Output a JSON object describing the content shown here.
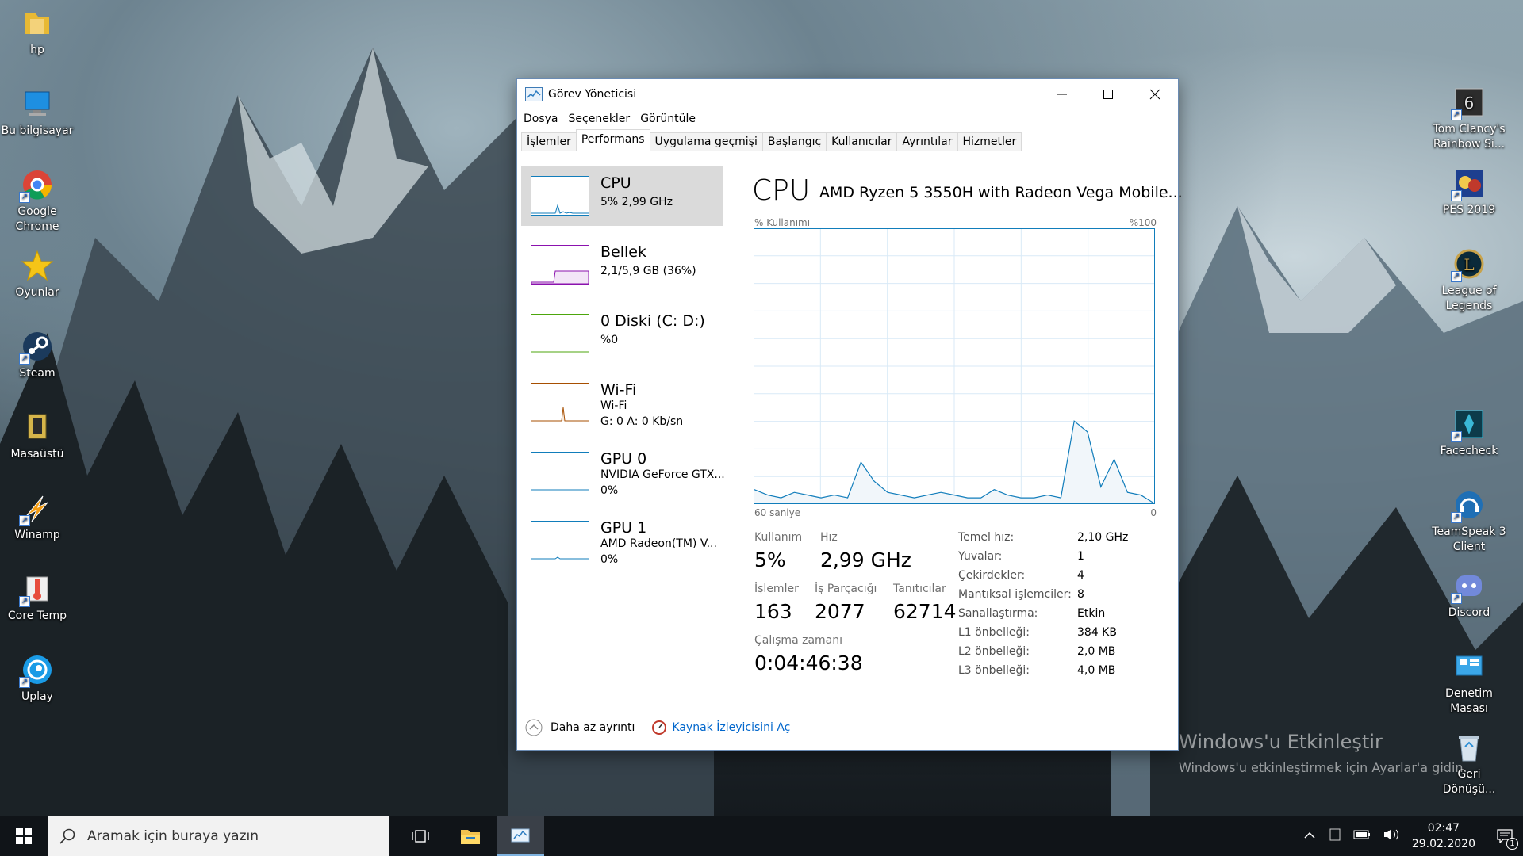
{
  "desktop": {
    "left_icons": [
      {
        "label": "hp",
        "icon": "folder-icon"
      },
      {
        "label": "Bu bilgisayar",
        "icon": "computer-icon"
      },
      {
        "label": "Google Chrome",
        "icon": "chrome-icon"
      },
      {
        "label": "Oyunlar",
        "icon": "star-icon"
      },
      {
        "label": "Steam",
        "icon": "steam-icon"
      },
      {
        "label": "Masaüstü",
        "icon": "folder-icon"
      },
      {
        "label": "Winamp",
        "icon": "winamp-icon"
      },
      {
        "label": "Core Temp",
        "icon": "thermometer-icon"
      },
      {
        "label": "Uplay",
        "icon": "uplay-icon"
      }
    ],
    "right_icons": [
      {
        "label": "Tom Clancy's Rainbow Si...",
        "icon": "rainbow-six-icon"
      },
      {
        "label": "PES 2019",
        "icon": "pes-icon"
      },
      {
        "label": "League of Legends",
        "icon": "league-icon"
      },
      {
        "label": "Facecheck",
        "icon": "facecheck-icon"
      },
      {
        "label": "TeamSpeak 3 Client",
        "icon": "teamspeak-icon"
      },
      {
        "label": "Discord",
        "icon": "discord-icon"
      },
      {
        "label": "Denetim Masası",
        "icon": "control-panel-icon"
      },
      {
        "label": "Geri Dönüşü...",
        "icon": "recycle-bin-icon"
      }
    ],
    "watermark_title": "Windows'u Etkinleştir",
    "watermark_sub": "Windows'u etkinleştirmek için Ayarlar'a gidin."
  },
  "window": {
    "title": "Görev Yöneticisi",
    "menu": [
      "Dosya",
      "Seçenekler",
      "Görüntüle"
    ],
    "tabs": [
      "İşlemler",
      "Performans",
      "Uygulama geçmişi",
      "Başlangıç",
      "Kullanıcılar",
      "Ayrıntılar",
      "Hizmetler"
    ],
    "active_tab": "Performans",
    "side_items": [
      {
        "name": "CPU",
        "line1": "5%  2,99 GHz",
        "line2": "",
        "color": "#117dbb"
      },
      {
        "name": "Bellek",
        "line1": "2,1/5,9 GB (36%)",
        "line2": "",
        "color": "#8b12ae"
      },
      {
        "name": "0 Diski (C: D:)",
        "line1": "%0",
        "line2": "",
        "color": "#4da60c"
      },
      {
        "name": "Wi-Fi",
        "line1": "Wi-Fi",
        "line2": "G: 0  A: 0 Kb/sn",
        "color": "#a74f01"
      },
      {
        "name": "GPU 0",
        "line1": "NVIDIA GeForce GTX...",
        "line2": "0%",
        "color": "#117dbb"
      },
      {
        "name": "GPU 1",
        "line1": "AMD Radeon(TM) V...",
        "line2": "0%",
        "color": "#117dbb"
      }
    ],
    "detail": {
      "heading": "CPU",
      "model": "AMD Ryzen 5 3550H with Radeon Vega Mobile...",
      "graph_label_left": "% Kullanımı",
      "graph_label_right": "%100",
      "graph_footer_left": "60 saniye",
      "graph_footer_right": "0",
      "usage_label": "Kullanım",
      "usage_value": "5%",
      "speed_label": "Hız",
      "speed_value": "2,99 GHz",
      "processes_label": "İşlemler",
      "processes_value": "163",
      "threads_label": "İş Parçacığı",
      "threads_value": "2077",
      "handles_label": "Tanıtıcılar",
      "handles_value": "62714",
      "uptime_label": "Çalışma zamanı",
      "uptime_value": "0:04:46:38",
      "specs": [
        {
          "k": "Temel hız:",
          "v": "2,10 GHz"
        },
        {
          "k": "Yuvalar:",
          "v": "1"
        },
        {
          "k": "Çekirdekler:",
          "v": "4"
        },
        {
          "k": "Mantıksal işlemciler:",
          "v": "8"
        },
        {
          "k": "Sanallaştırma:",
          "v": "Etkin"
        },
        {
          "k": "L1 önbelleği:",
          "v": "384 KB"
        },
        {
          "k": "L2 önbelleği:",
          "v": "2,0 MB"
        },
        {
          "k": "L3 önbelleği:",
          "v": "4,0 MB"
        }
      ]
    },
    "footer_less": "Daha az ayrıntı",
    "footer_monitor": "Kaynak İzleyicisini Aç"
  },
  "chart_data": {
    "type": "area",
    "title": "",
    "ylim": [
      0,
      100
    ],
    "x": [
      0,
      2,
      4,
      6,
      8,
      10,
      12,
      14,
      16,
      18,
      20,
      22,
      24,
      26,
      28,
      30,
      32,
      34,
      36,
      38,
      40,
      42,
      44,
      46,
      48,
      50,
      52,
      54,
      56,
      58,
      60
    ],
    "values": [
      0,
      0,
      0,
      0,
      0,
      0,
      0,
      0,
      0,
      0,
      0,
      0,
      0,
      0,
      0,
      0,
      0,
      0,
      0,
      0,
      0,
      0,
      0,
      0,
      0,
      0,
      0,
      0,
      0,
      0,
      0
    ],
    "series": [
      {
        "values": [
          5,
          3,
          2,
          4,
          3,
          2,
          3,
          2,
          15,
          8,
          4,
          3,
          2,
          3,
          4,
          3,
          2,
          2,
          5,
          3,
          2,
          2,
          3,
          2,
          30,
          26,
          6,
          16,
          4,
          3,
          0
        ]
      }
    ]
  },
  "taskbar": {
    "search_placeholder": "Aramak için buraya yazın",
    "time": "02:47",
    "date": "29.02.2020",
    "notification_count": "1"
  }
}
